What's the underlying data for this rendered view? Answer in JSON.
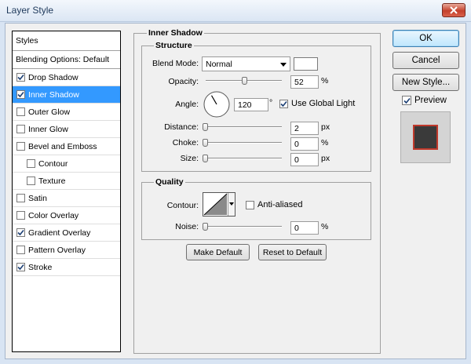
{
  "window": {
    "title": "Layer Style"
  },
  "styles_panel": {
    "header": "Styles",
    "blending_options": "Blending Options: Default",
    "items": [
      {
        "label": "Drop Shadow",
        "checked": true,
        "indent": false,
        "selected": false
      },
      {
        "label": "Inner Shadow",
        "checked": true,
        "indent": false,
        "selected": true
      },
      {
        "label": "Outer Glow",
        "checked": false,
        "indent": false,
        "selected": false
      },
      {
        "label": "Inner Glow",
        "checked": false,
        "indent": false,
        "selected": false
      },
      {
        "label": "Bevel and Emboss",
        "checked": false,
        "indent": false,
        "selected": false
      },
      {
        "label": "Contour",
        "checked": false,
        "indent": true,
        "selected": false
      },
      {
        "label": "Texture",
        "checked": false,
        "indent": true,
        "selected": false
      },
      {
        "label": "Satin",
        "checked": false,
        "indent": false,
        "selected": false
      },
      {
        "label": "Color Overlay",
        "checked": false,
        "indent": false,
        "selected": false
      },
      {
        "label": "Gradient Overlay",
        "checked": true,
        "indent": false,
        "selected": false
      },
      {
        "label": "Pattern Overlay",
        "checked": false,
        "indent": false,
        "selected": false
      },
      {
        "label": "Stroke",
        "checked": true,
        "indent": false,
        "selected": false
      }
    ]
  },
  "inner_shadow": {
    "title": "Inner Shadow",
    "structure": {
      "title": "Structure",
      "blend_mode_label": "Blend Mode:",
      "blend_mode_value": "Normal",
      "blend_color": "#ffffff",
      "opacity_label": "Opacity:",
      "opacity_value": "52",
      "opacity_unit": "%",
      "opacity_fraction": 0.52,
      "angle_label": "Angle:",
      "angle_value": "120",
      "angle_unit": "°",
      "angle_degrees": 120,
      "use_global_light_label": "Use Global Light",
      "use_global_light_checked": true,
      "distance_label": "Distance:",
      "distance_value": "2",
      "distance_unit": "px",
      "distance_fraction": 0.0,
      "choke_label": "Choke:",
      "choke_value": "0",
      "choke_unit": "%",
      "choke_fraction": 0.0,
      "size_label": "Size:",
      "size_value": "0",
      "size_unit": "px",
      "size_fraction": 0.0
    },
    "quality": {
      "title": "Quality",
      "contour_label": "Contour:",
      "anti_aliased_label": "Anti-aliased",
      "anti_aliased_checked": false,
      "noise_label": "Noise:",
      "noise_value": "0",
      "noise_unit": "%",
      "noise_fraction": 0.0
    },
    "make_default_label": "Make Default",
    "reset_default_label": "Reset to Default"
  },
  "buttons": {
    "ok": "OK",
    "cancel": "Cancel",
    "new_style": "New Style...",
    "preview_label": "Preview",
    "preview_checked": true
  },
  "colors": {
    "selection": "#3399ff",
    "preview_swatch": "#3a3a3a",
    "preview_stroke": "#c0392b"
  },
  "icons": {
    "close": "close-icon",
    "check": "checkmark-icon",
    "dropdown": "dropdown-arrow-icon",
    "angle_dial": "angle-dial-icon",
    "contour_preview": "contour-preview-icon"
  }
}
